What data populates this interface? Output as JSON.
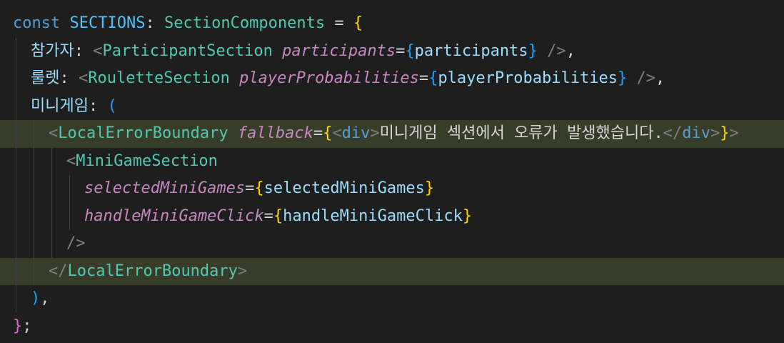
{
  "theme": {
    "background": "#1e1e1e",
    "highlight": "#373d29",
    "keyword": "#569cd6",
    "constant": "#4fc1ff",
    "type": "#4ec9b0",
    "bracket_gold": "#ffd700",
    "bracket_purple": "#da70d6",
    "bracket_blue": "#179fff"
  },
  "code": {
    "lines": [
      {
        "highlighted": false,
        "indent": 0,
        "tokens": [
          {
            "t": "const ",
            "c": "kw"
          },
          {
            "t": "SECTIONS",
            "c": "var"
          },
          {
            "t": ": ",
            "c": "plain"
          },
          {
            "t": "SectionComponents",
            "c": "type"
          },
          {
            "t": " = ",
            "c": "plain"
          },
          {
            "t": "{",
            "c": "b1"
          }
        ]
      },
      {
        "highlighted": false,
        "indent": 1,
        "tokens": [
          {
            "t": "참가자",
            "c": "prop"
          },
          {
            "t": ": ",
            "c": "plain"
          },
          {
            "t": "<",
            "c": "punct"
          },
          {
            "t": "ParticipantSection",
            "c": "tag"
          },
          {
            "t": " ",
            "c": "plain"
          },
          {
            "t": "participants",
            "c": "attr"
          },
          {
            "t": "=",
            "c": "plain"
          },
          {
            "t": "{",
            "c": "b3"
          },
          {
            "t": "participants",
            "c": "prop"
          },
          {
            "t": "}",
            "c": "b3"
          },
          {
            "t": " ",
            "c": "plain"
          },
          {
            "t": "/>",
            "c": "punct"
          },
          {
            "t": ",",
            "c": "plain"
          }
        ]
      },
      {
        "highlighted": false,
        "indent": 1,
        "tokens": [
          {
            "t": "룰렛",
            "c": "prop"
          },
          {
            "t": ": ",
            "c": "plain"
          },
          {
            "t": "<",
            "c": "punct"
          },
          {
            "t": "RouletteSection",
            "c": "tag"
          },
          {
            "t": " ",
            "c": "plain"
          },
          {
            "t": "playerProbabilities",
            "c": "attr"
          },
          {
            "t": "=",
            "c": "plain"
          },
          {
            "t": "{",
            "c": "b3"
          },
          {
            "t": "playerProbabilities",
            "c": "prop"
          },
          {
            "t": "}",
            "c": "b3"
          },
          {
            "t": " ",
            "c": "plain"
          },
          {
            "t": "/>",
            "c": "punct"
          },
          {
            "t": ",",
            "c": "plain"
          }
        ]
      },
      {
        "highlighted": false,
        "indent": 1,
        "tokens": [
          {
            "t": "미니게임",
            "c": "prop"
          },
          {
            "t": ": ",
            "c": "plain"
          },
          {
            "t": "(",
            "c": "b3"
          }
        ]
      },
      {
        "highlighted": true,
        "indent": 2,
        "tokens": [
          {
            "t": "<",
            "c": "punct"
          },
          {
            "t": "LocalErrorBoundary",
            "c": "tag"
          },
          {
            "t": " ",
            "c": "plain"
          },
          {
            "t": "fallback",
            "c": "attr"
          },
          {
            "t": "=",
            "c": "plain"
          },
          {
            "t": "{",
            "c": "b1"
          },
          {
            "t": "<",
            "c": "punct"
          },
          {
            "t": "div",
            "c": "kw"
          },
          {
            "t": ">",
            "c": "punct"
          },
          {
            "t": "미니게임 섹션에서 오류가 발생했습니다.",
            "c": "txt"
          },
          {
            "t": "</",
            "c": "punct"
          },
          {
            "t": "div",
            "c": "kw"
          },
          {
            "t": ">",
            "c": "punct"
          },
          {
            "t": "}",
            "c": "b1"
          },
          {
            "t": ">",
            "c": "punct"
          }
        ]
      },
      {
        "highlighted": false,
        "indent": 3,
        "tokens": [
          {
            "t": "<",
            "c": "punct"
          },
          {
            "t": "MiniGameSection",
            "c": "tag"
          }
        ]
      },
      {
        "highlighted": false,
        "indent": 4,
        "tokens": [
          {
            "t": "selectedMiniGames",
            "c": "attr"
          },
          {
            "t": "=",
            "c": "plain"
          },
          {
            "t": "{",
            "c": "b1"
          },
          {
            "t": "selectedMiniGames",
            "c": "prop"
          },
          {
            "t": "}",
            "c": "b1"
          }
        ]
      },
      {
        "highlighted": false,
        "indent": 4,
        "tokens": [
          {
            "t": "handleMiniGameClick",
            "c": "attr"
          },
          {
            "t": "=",
            "c": "plain"
          },
          {
            "t": "{",
            "c": "b1"
          },
          {
            "t": "handleMiniGameClick",
            "c": "prop"
          },
          {
            "t": "}",
            "c": "b1"
          }
        ]
      },
      {
        "highlighted": false,
        "indent": 3,
        "tokens": [
          {
            "t": "/>",
            "c": "punct"
          }
        ]
      },
      {
        "highlighted": true,
        "indent": 2,
        "tokens": [
          {
            "t": "</",
            "c": "punct"
          },
          {
            "t": "LocalErrorBoundary",
            "c": "tag"
          },
          {
            "t": ">",
            "c": "punct"
          }
        ]
      },
      {
        "highlighted": false,
        "indent": 1,
        "tokens": [
          {
            "t": ")",
            "c": "b3"
          },
          {
            "t": ",",
            "c": "plain"
          }
        ]
      },
      {
        "highlighted": false,
        "indent": 0,
        "tokens": [
          {
            "t": "}",
            "c": "b2"
          },
          {
            "t": ";",
            "c": "plain"
          }
        ]
      }
    ]
  }
}
